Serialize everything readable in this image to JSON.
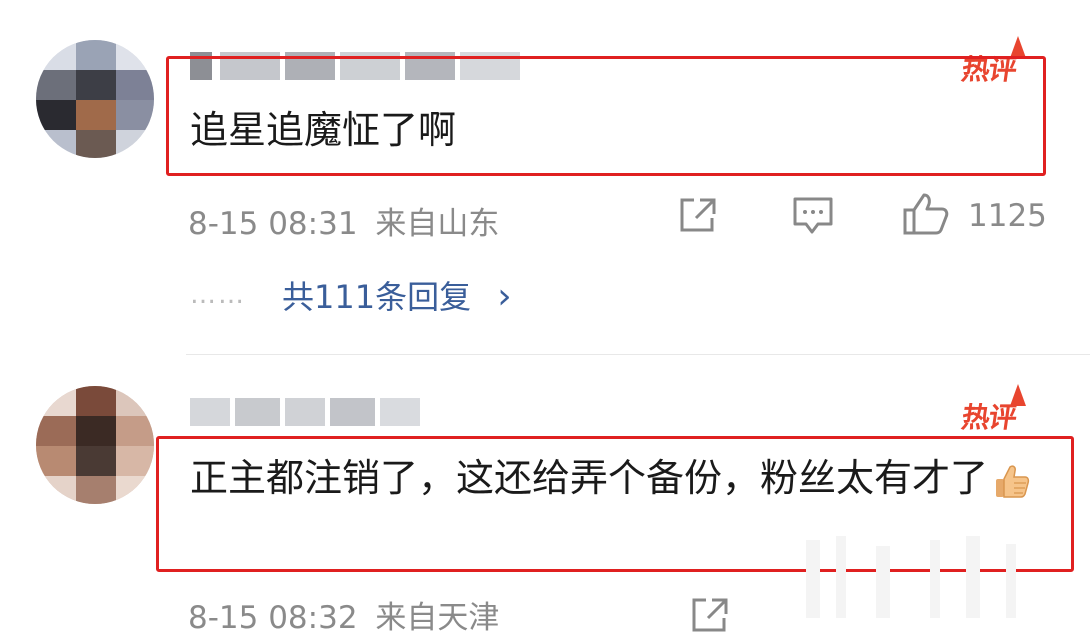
{
  "comments": [
    {
      "badge": "热评",
      "content": "追星追魔怔了啊",
      "time": "8-15 08:31",
      "location": "来自山东",
      "likes": "1125",
      "replies": "共111条回复",
      "replies_chevron": "›",
      "dots": "……"
    },
    {
      "badge": "热评",
      "content": "正主都注销了，这还给弄个备份，粉丝太有才了",
      "time": "8-15 08:32",
      "location": "来自天津"
    }
  ],
  "icons": {
    "share": "share-icon",
    "comment": "comment-icon",
    "like": "like-icon",
    "emoji": "thumbs-up-emoji"
  },
  "colors": {
    "highlight_box": "#e02020",
    "hot_badge": "#e8452f",
    "reply_link": "#3a5e9a",
    "meta_text": "#8a8a8a"
  }
}
